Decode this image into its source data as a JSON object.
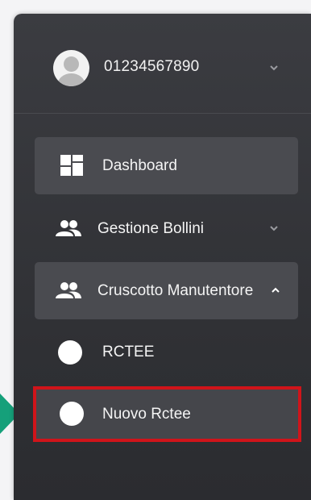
{
  "user": {
    "name": "01234567890",
    "avatar_icon": "user-avatar-icon",
    "expand_icon": "chevron-down-icon"
  },
  "menu": {
    "dashboard": {
      "label": "Dashboard",
      "icon": "dashboard-grid-icon",
      "active": true
    },
    "gestione_bollini": {
      "label": "Gestione Bollini",
      "icon": "users-icon",
      "expand_icon": "chevron-down-icon"
    },
    "cruscotto": {
      "label": "Cruscotto Manutentore",
      "icon": "users-icon",
      "expand_icon": "chevron-up-icon",
      "active": true
    },
    "sub_items": [
      {
        "label": "RCTEE",
        "icon": "circle-icon"
      },
      {
        "label": "Nuovo Rctee",
        "icon": "circle-icon",
        "highlighted": true
      }
    ]
  },
  "colors": {
    "sidebar_bg": "#35363a",
    "active_bg": "#4a4b50",
    "text": "#f4f4f4",
    "highlight_border": "#d0141a",
    "arrow": "#15a07a"
  }
}
